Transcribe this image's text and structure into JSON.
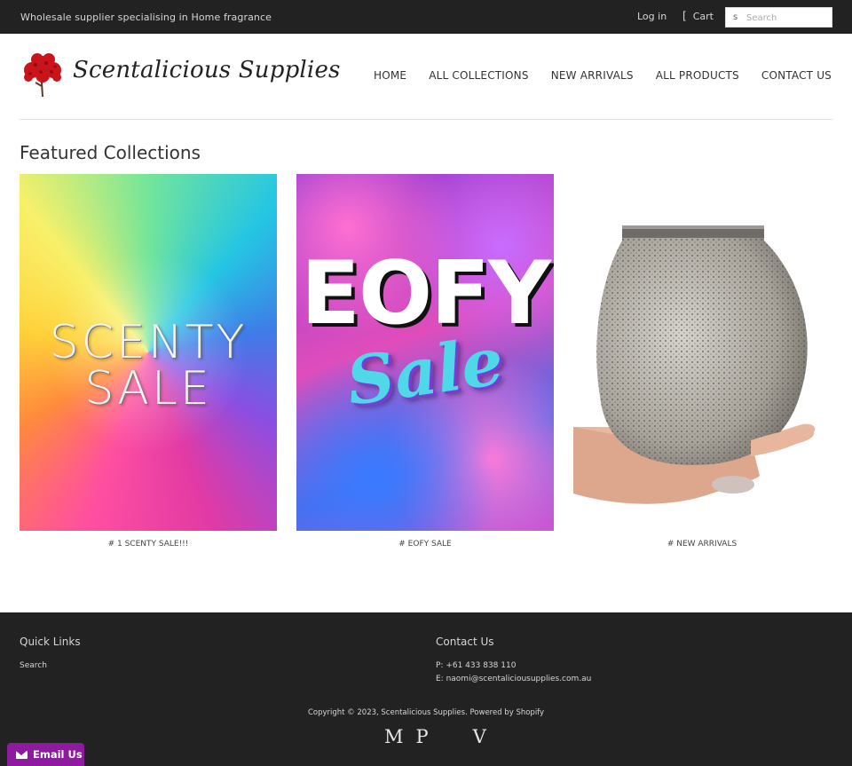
{
  "topbar": {
    "tagline": "Wholesale supplier specialising in Home fragrance",
    "login": "Log in",
    "cart": "Cart",
    "search_placeholder": "Search"
  },
  "header": {
    "logo_text": "Scentalicious Supplies",
    "nav": [
      "HOME",
      "ALL COLLECTIONS",
      "NEW ARRIVALS",
      "ALL PRODUCTS",
      "CONTACT US"
    ]
  },
  "featured": {
    "title": "Featured Collections",
    "collections": [
      {
        "caption": "# 1 SCENTY SALE!!!",
        "image_text": [
          "SCENTY",
          "SALE"
        ]
      },
      {
        "caption": "# EOFY SALE",
        "image_text": [
          "EOFY",
          "Sale"
        ]
      },
      {
        "caption": "# NEW ARRIVALS"
      }
    ]
  },
  "footer": {
    "quick_links_title": "Quick Links",
    "quick_links": [
      "Search"
    ],
    "contact_title": "Contact Us",
    "phone": "P: +61 433 838 110",
    "email": "E: naomi@scentaliciousupplies.com.au",
    "copyright": "Copyright © 2023, Scentalicious Supplies. Powered by Shopify",
    "payment_glyphs": [
      "M",
      "P",
      "V"
    ]
  },
  "email_widget": {
    "label": "Email Us"
  },
  "colors": {
    "topbar_bg": "#222222",
    "footer_bg": "#222222",
    "email_widget": "#8d1b9e"
  }
}
